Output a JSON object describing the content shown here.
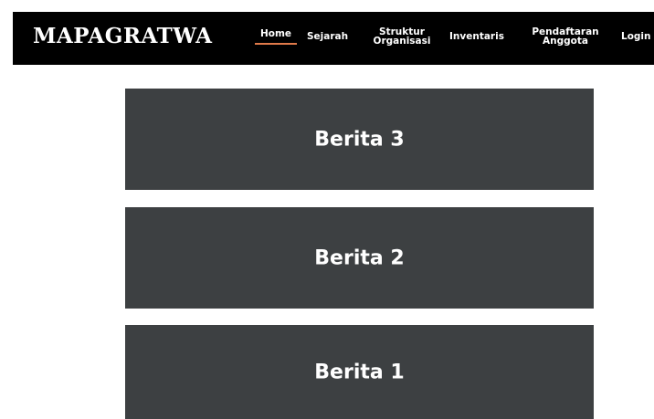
{
  "brand": "MAPAGRATWA",
  "nav": {
    "home": "Home",
    "sejarah": "Sejarah",
    "struktur_line1": "Struktur",
    "struktur_line2": "Organisasi",
    "inventaris": "Inventaris",
    "pendaftaran_line1": "Pendaftaran",
    "pendaftaran_line2": "Anggota",
    "login": "Login"
  },
  "news": [
    {
      "title": "Berita 3"
    },
    {
      "title": "Berita 2"
    },
    {
      "title": "Berita 1"
    }
  ],
  "colors": {
    "navbar_bg": "#000000",
    "active_underline": "#e07a4a",
    "card_bg": "#3d4042",
    "text": "#ffffff"
  }
}
